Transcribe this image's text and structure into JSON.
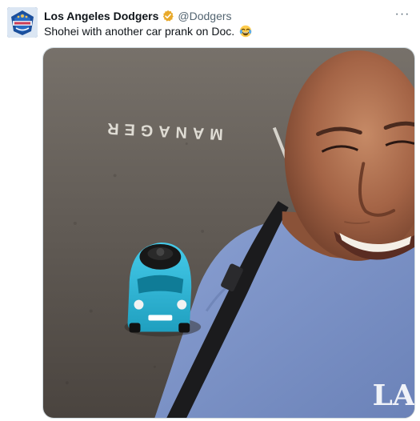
{
  "post": {
    "author": {
      "display_name": "Los Angeles Dodgers",
      "handle": "@Dodgers",
      "verified_icon": "verified-badge-icon",
      "verified_color": "#e8a92a"
    },
    "text": "Shohei with another car prank on Doc.",
    "emoji": "face-with-tears-of-joy",
    "more_label": "···",
    "media": {
      "pavement_text": "MANAGER",
      "logo_text": "LA"
    }
  },
  "colors": {
    "toy_car": "#2bb6d6",
    "shirt": "#7e95c9",
    "asphalt": "#5b554f"
  }
}
